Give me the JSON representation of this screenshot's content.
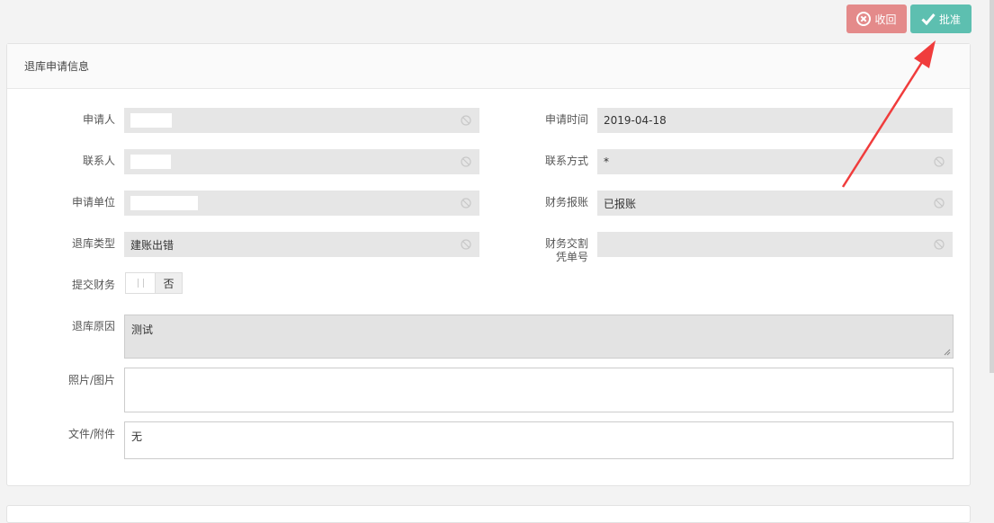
{
  "toolbar": {
    "withdraw_label": "收回",
    "approve_label": "批准"
  },
  "panel": {
    "title": "退库申请信息"
  },
  "fields": {
    "applicant": {
      "label": "申请人",
      "value": ""
    },
    "apply_time": {
      "label": "申请时间",
      "value": "2019-04-18"
    },
    "contact_person": {
      "label": "联系人",
      "value": ""
    },
    "contact_method": {
      "label": "联系方式",
      "value": "*"
    },
    "apply_unit": {
      "label": "申请单位",
      "value": ""
    },
    "finance_reimburse": {
      "label": "财务报账",
      "value": "已报账"
    },
    "return_type": {
      "label": "退库类型",
      "value": "建账出错"
    },
    "finance_voucher": {
      "label_line1": "财务交割",
      "label_line2": "凭单号",
      "value": ""
    },
    "submit_finance": {
      "label": "提交财务",
      "value": "否"
    },
    "return_reason": {
      "label": "退库原因",
      "value": "测试"
    },
    "photo": {
      "label": "照片/图片",
      "value": ""
    },
    "attachment": {
      "label": "文件/附件",
      "value": "无"
    }
  },
  "colors": {
    "withdraw": "#e48a8a",
    "approve": "#5dbfb0",
    "annotation_arrow": "#f03c3c"
  }
}
